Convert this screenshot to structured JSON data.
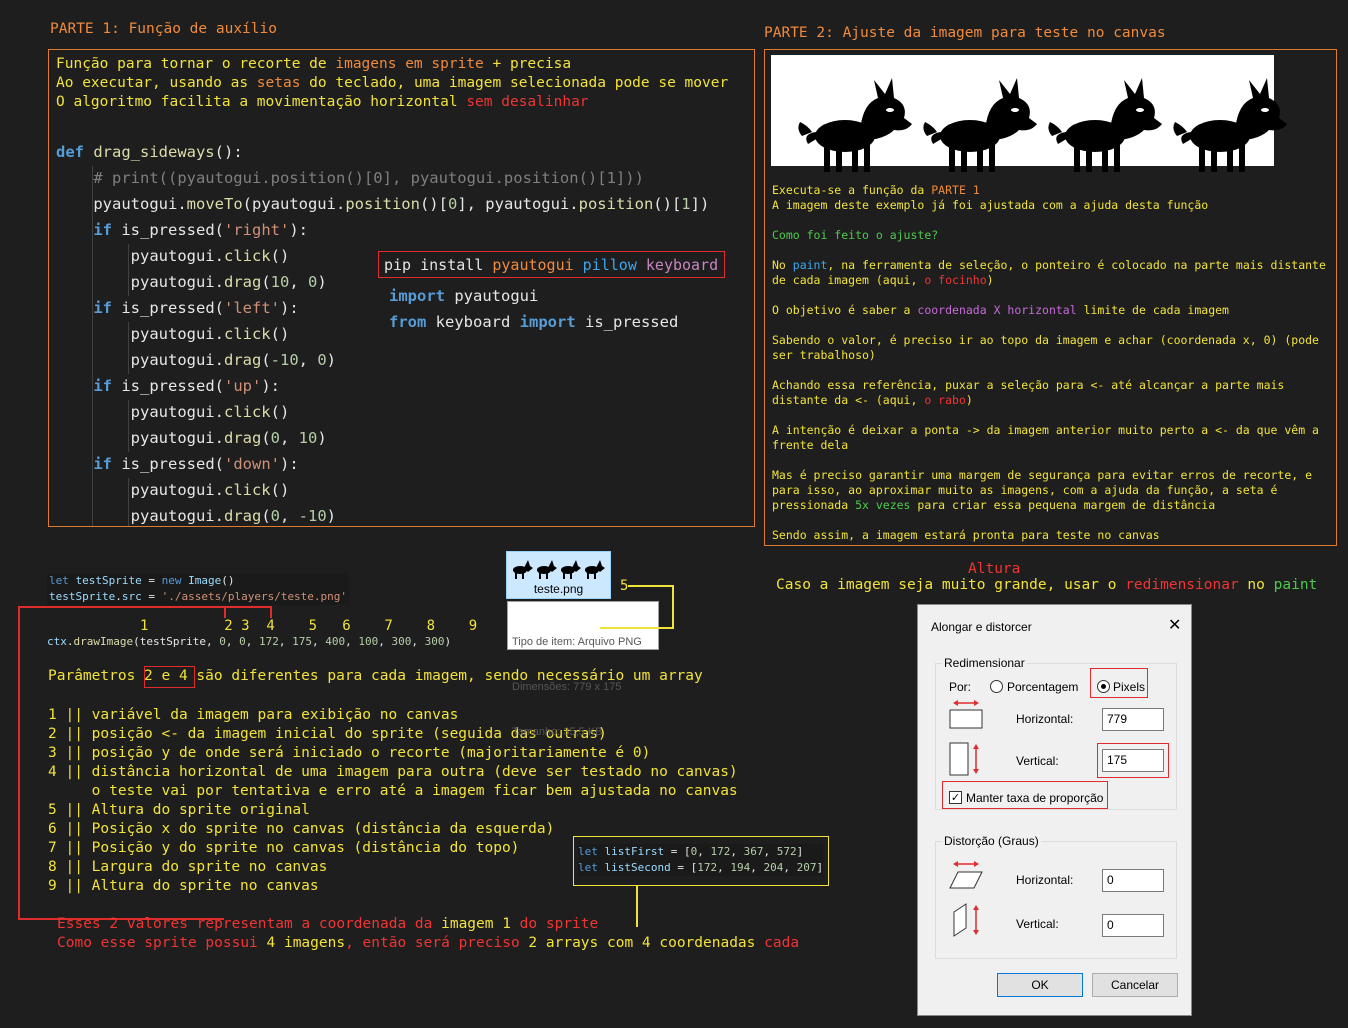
{
  "part1": {
    "title": "PARTE 1: Função de auxílio",
    "desc": [
      [
        {
          "t": "Função para tornar o recorte de ",
          "c": "c-yellow"
        },
        {
          "t": "imagens em sprite",
          "c": "c-orange"
        },
        {
          "t": " + precisa",
          "c": "c-yellow"
        }
      ],
      [
        {
          "t": "Ao executar, usando as ",
          "c": "c-yellow"
        },
        {
          "t": "setas",
          "c": "c-orange"
        },
        {
          "t": " do teclado, uma imagem selecionada pode se mover",
          "c": "c-yellow"
        }
      ],
      [
        {
          "t": "O algoritmo facilita a movimentação horizontal ",
          "c": "c-yellow"
        },
        {
          "t": "sem desalinhar",
          "c": "c-red"
        }
      ]
    ],
    "code_lines": [
      [
        {
          "t": "def ",
          "c": "kw"
        },
        {
          "t": "drag_sideways",
          "c": "fn"
        },
        {
          "t": "():",
          "c": "c-white"
        }
      ],
      [
        {
          "t": "    # print((pyautogui.position()[0], pyautogui.position()[1]))",
          "c": "cmt2"
        }
      ],
      [
        {
          "t": "    pyautogui.",
          "c": "c-white"
        },
        {
          "t": "moveTo",
          "c": "fn"
        },
        {
          "t": "(pyautogui.",
          "c": "c-white"
        },
        {
          "t": "position",
          "c": "fn"
        },
        {
          "t": "()[",
          "c": "c-white"
        },
        {
          "t": "0",
          "c": "num"
        },
        {
          "t": "], pyautogui.",
          "c": "c-white"
        },
        {
          "t": "position",
          "c": "fn"
        },
        {
          "t": "()[",
          "c": "c-white"
        },
        {
          "t": "1",
          "c": "num"
        },
        {
          "t": "])",
          "c": "c-white"
        }
      ],
      [
        {
          "t": "    if ",
          "c": "kw"
        },
        {
          "t": "is_pressed",
          "c": "c-white"
        },
        {
          "t": "(",
          "c": "c-white"
        },
        {
          "t": "'right'",
          "c": "str"
        },
        {
          "t": "):",
          "c": "c-white"
        }
      ],
      [
        {
          "t": "        pyautogui.",
          "c": "c-white"
        },
        {
          "t": "click",
          "c": "fn"
        },
        {
          "t": "()",
          "c": "c-white"
        }
      ],
      [
        {
          "t": "        pyautogui.",
          "c": "c-white"
        },
        {
          "t": "drag",
          "c": "fn"
        },
        {
          "t": "(",
          "c": "c-white"
        },
        {
          "t": "10",
          "c": "num"
        },
        {
          "t": ", ",
          "c": "c-white"
        },
        {
          "t": "0",
          "c": "num"
        },
        {
          "t": ")",
          "c": "c-white"
        }
      ],
      [
        {
          "t": "    if ",
          "c": "kw"
        },
        {
          "t": "is_pressed",
          "c": "c-white"
        },
        {
          "t": "(",
          "c": "c-white"
        },
        {
          "t": "'left'",
          "c": "str"
        },
        {
          "t": "):",
          "c": "c-white"
        }
      ],
      [
        {
          "t": "        pyautogui.",
          "c": "c-white"
        },
        {
          "t": "click",
          "c": "fn"
        },
        {
          "t": "()",
          "c": "c-white"
        }
      ],
      [
        {
          "t": "        pyautogui.",
          "c": "c-white"
        },
        {
          "t": "drag",
          "c": "fn"
        },
        {
          "t": "(",
          "c": "c-white"
        },
        {
          "t": "-10",
          "c": "num"
        },
        {
          "t": ", ",
          "c": "c-white"
        },
        {
          "t": "0",
          "c": "num"
        },
        {
          "t": ")",
          "c": "c-white"
        }
      ],
      [
        {
          "t": "    if ",
          "c": "kw"
        },
        {
          "t": "is_pressed",
          "c": "c-white"
        },
        {
          "t": "(",
          "c": "c-white"
        },
        {
          "t": "'up'",
          "c": "str"
        },
        {
          "t": "):",
          "c": "c-white"
        }
      ],
      [
        {
          "t": "        pyautogui.",
          "c": "c-white"
        },
        {
          "t": "click",
          "c": "fn"
        },
        {
          "t": "()",
          "c": "c-white"
        }
      ],
      [
        {
          "t": "        pyautogui.",
          "c": "c-white"
        },
        {
          "t": "drag",
          "c": "fn"
        },
        {
          "t": "(",
          "c": "c-white"
        },
        {
          "t": "0",
          "c": "num"
        },
        {
          "t": ", ",
          "c": "c-white"
        },
        {
          "t": "10",
          "c": "num"
        },
        {
          "t": ")",
          "c": "c-white"
        }
      ],
      [
        {
          "t": "    if ",
          "c": "kw"
        },
        {
          "t": "is_pressed",
          "c": "c-white"
        },
        {
          "t": "(",
          "c": "c-white"
        },
        {
          "t": "'down'",
          "c": "str"
        },
        {
          "t": "):",
          "c": "c-white"
        }
      ],
      [
        {
          "t": "        pyautogui.",
          "c": "c-white"
        },
        {
          "t": "click",
          "c": "fn"
        },
        {
          "t": "()",
          "c": "c-white"
        }
      ],
      [
        {
          "t": "        pyautogui.",
          "c": "c-white"
        },
        {
          "t": "drag",
          "c": "fn"
        },
        {
          "t": "(",
          "c": "c-white"
        },
        {
          "t": "0",
          "c": "num"
        },
        {
          "t": ", ",
          "c": "c-white"
        },
        {
          "t": "-10",
          "c": "num"
        },
        {
          "t": ")",
          "c": "c-white"
        }
      ]
    ],
    "pip": [
      {
        "t": "pip install ",
        "c": "c-white"
      },
      {
        "t": "pyautogui",
        "c": "c-orange"
      },
      {
        "t": " pillow",
        "c": "c-blue"
      },
      {
        "t": " keyboard",
        "c": "c-purple"
      }
    ],
    "imports": [
      [
        {
          "t": "import",
          "c": "kw"
        },
        {
          "t": " pyautogui",
          "c": "c-white"
        }
      ],
      [
        {
          "t": "from",
          "c": "kw"
        },
        {
          "t": " keyboard ",
          "c": "c-white"
        },
        {
          "t": "import",
          "c": "kw"
        },
        {
          "t": " is_pressed",
          "c": "c-white"
        }
      ]
    ]
  },
  "part2": {
    "title": "PARTE 2: Ajuste da imagem para teste no canvas",
    "paragraphs": [
      [
        [
          {
            "t": "Executa-se a função da ",
            "c": "c-yellow"
          },
          {
            "t": "PARTE 1",
            "c": "c-orange"
          }
        ],
        [
          {
            "t": "A imagem deste exemplo já foi ajustada com a ajuda desta função",
            "c": "c-yellow"
          }
        ]
      ],
      [
        [
          {
            "t": "Como foi feito o ajuste?",
            "c": "c-green"
          }
        ]
      ],
      [
        [
          {
            "t": "No ",
            "c": "c-yellow"
          },
          {
            "t": "paint",
            "c": "c-blue"
          },
          {
            "t": ", na ferramenta de seleção, o ponteiro é colocado na parte mais distante",
            "c": "c-yellow"
          }
        ],
        [
          {
            "t": "de cada imagem (aqui, ",
            "c": "c-yellow"
          },
          {
            "t": "o focinho",
            "c": "c-red"
          },
          {
            "t": ")",
            "c": "c-yellow"
          }
        ]
      ],
      [
        [
          {
            "t": "O objetivo é saber a ",
            "c": "c-yellow"
          },
          {
            "t": "coordenada X horizontal",
            "c": "c-magenta"
          },
          {
            "t": " limite de cada imagem",
            "c": "c-yellow"
          }
        ]
      ],
      [
        [
          {
            "t": "Sabendo o valor, é preciso ir ao topo da imagem e achar (coordenada x, 0) (pode",
            "c": "c-yellow"
          }
        ],
        [
          {
            "t": "ser trabalhoso)",
            "c": "c-yellow"
          }
        ]
      ],
      [
        [
          {
            "t": "Achando essa referência, puxar a seleção para <- até alcançar a parte mais",
            "c": "c-yellow"
          }
        ],
        [
          {
            "t": "distante da <- (aqui, ",
            "c": "c-yellow"
          },
          {
            "t": "o rabo",
            "c": "c-red"
          },
          {
            "t": ")",
            "c": "c-yellow"
          }
        ]
      ],
      [
        [
          {
            "t": "A intenção é deixar a ponta -> da imagem anterior muito perto a <- da que vêm a",
            "c": "c-yellow"
          }
        ],
        [
          {
            "t": "frente dela",
            "c": "c-yellow"
          }
        ]
      ],
      [
        [
          {
            "t": "Mas é preciso garantir uma margem de segurança para evitar erros de recorte, e",
            "c": "c-yellow"
          }
        ],
        [
          {
            "t": "para isso, ao aproximar muito as imagens, com a ajuda da função, a seta é",
            "c": "c-yellow"
          }
        ],
        [
          {
            "t": "pressionada ",
            "c": "c-yellow"
          },
          {
            "t": "5x vezes",
            "c": "c-green"
          },
          {
            "t": " para criar essa pequena margem de distância",
            "c": "c-yellow"
          }
        ]
      ],
      [
        [
          {
            "t": "Sendo assim, a imagem estará pronta para teste no canvas",
            "c": "c-yellow"
          }
        ]
      ]
    ]
  },
  "js": {
    "line1": [
      {
        "t": "let",
        "c": "js-let"
      },
      {
        "t": " testSprite",
        "c": "js-var"
      },
      {
        "t": " = ",
        "c": "c-white"
      },
      {
        "t": "new",
        "c": "js-let"
      },
      {
        "t": " Image",
        "c": "js-var"
      },
      {
        "t": "()",
        "c": "c-white"
      }
    ],
    "line2": [
      {
        "t": "testSprite",
        "c": "js-var"
      },
      {
        "t": ".",
        "c": "c-white"
      },
      {
        "t": "src",
        "c": "js-var"
      },
      {
        "t": " = ",
        "c": "c-white"
      },
      {
        "t": "'./assets/players/teste.png'",
        "c": "str"
      }
    ],
    "param_numbers": "1         2 3  4    5   6    7    8    9",
    "draw_line": [
      {
        "t": "ctx",
        "c": "js-var"
      },
      {
        "t": ".",
        "c": "c-white"
      },
      {
        "t": "drawImage",
        "c": "fn"
      },
      {
        "t": "(testSprite, ",
        "c": "c-white"
      },
      {
        "t": "0",
        "c": "num"
      },
      {
        "t": ", ",
        "c": "c-white"
      },
      {
        "t": "0",
        "c": "num"
      },
      {
        "t": ", ",
        "c": "c-white"
      },
      {
        "t": "172",
        "c": "num"
      },
      {
        "t": ", ",
        "c": "c-white"
      },
      {
        "t": "175",
        "c": "num"
      },
      {
        "t": ", ",
        "c": "c-white"
      },
      {
        "t": "400",
        "c": "num"
      },
      {
        "t": ", ",
        "c": "c-white"
      },
      {
        "t": "100",
        "c": "num"
      },
      {
        "t": ", ",
        "c": "c-white"
      },
      {
        "t": "300",
        "c": "num"
      },
      {
        "t": ", ",
        "c": "c-white"
      },
      {
        "t": "300",
        "c": "num"
      },
      {
        "t": ")",
        "c": "c-white"
      }
    ]
  },
  "params_line": [
    {
      "t": "Parâmetros ",
      "c": "c-yellow"
    },
    {
      "t": "2 e 4",
      "c": "c-yellow"
    },
    {
      "t": " são diferentes para cada imagem, sendo necessário um array",
      "c": "c-yellow"
    }
  ],
  "param_list": [
    "1 || variável da imagem para exibição no canvas",
    "2 || posição <- da imagem inicial do sprite (seguida das outras)",
    "3 || posição y de onde será iniciado o recorte (majoritariamente é 0)",
    "4 || distância horizontal de uma imagem para outra (deve ser testado no canvas)",
    "     o teste vai por tentativa e erro até a imagem ficar bem ajustada no canvas",
    "5 || Altura do sprite original",
    "6 || Posição x do sprite no canvas (distância da esquerda)",
    "7 || Posição y do sprite no canvas (distância do topo)",
    "8 || Largura do sprite no canvas",
    "9 || Altura do sprite no canvas"
  ],
  "red_note": [
    [
      {
        "t": "Esses 2 valores representam a coordenada da ",
        "c": "c-red"
      },
      {
        "t": "imagem 1",
        "c": "c-yellow"
      },
      {
        "t": " do sprite",
        "c": "c-red"
      }
    ],
    [
      {
        "t": "Como esse sprite possui ",
        "c": "c-red"
      },
      {
        "t": "4 imagens",
        "c": "c-yellow"
      },
      {
        "t": ", então será preciso ",
        "c": "c-red"
      },
      {
        "t": "2 arrays com 4 coordenadas",
        "c": "c-yellow"
      },
      {
        "t": " cada",
        "c": "c-red"
      }
    ]
  ],
  "file": {
    "name": "teste.png",
    "tooltip": [
      "Tipo de item: Arquivo PNG",
      "Dimensões: 779 x 175",
      "Tamanho: 35,5 KB"
    ],
    "marker": "5"
  },
  "arrays": {
    "first": [
      {
        "t": "let",
        "c": "js-let"
      },
      {
        "t": " listFirst",
        "c": "js-var"
      },
      {
        "t": " = [",
        "c": "c-white"
      },
      {
        "t": "0",
        "c": "num"
      },
      {
        "t": ", ",
        "c": "c-white"
      },
      {
        "t": "172",
        "c": "num"
      },
      {
        "t": ", ",
        "c": "c-white"
      },
      {
        "t": "367",
        "c": "num"
      },
      {
        "t": ", ",
        "c": "c-white"
      },
      {
        "t": "572",
        "c": "num"
      },
      {
        "t": "]",
        "c": "c-white"
      }
    ],
    "second": [
      {
        "t": "let",
        "c": "js-let"
      },
      {
        "t": " listSecond",
        "c": "js-var"
      },
      {
        "t": " = [",
        "c": "c-white"
      },
      {
        "t": "172",
        "c": "num"
      },
      {
        "t": ", ",
        "c": "c-white"
      },
      {
        "t": "194",
        "c": "num"
      },
      {
        "t": ", ",
        "c": "c-white"
      },
      {
        "t": "204",
        "c": "num"
      },
      {
        "t": ", ",
        "c": "c-white"
      },
      {
        "t": "207",
        "c": "num"
      },
      {
        "t": "]",
        "c": "c-white"
      }
    ]
  },
  "resize": {
    "altura": "Altura",
    "note": [
      {
        "t": "Caso a imagem seja muito grande, usar o ",
        "c": "c-yellow"
      },
      {
        "t": "redimensionar",
        "c": "c-red"
      },
      {
        "t": " no ",
        "c": "c-yellow"
      },
      {
        "t": "paint",
        "c": "c-green"
      }
    ]
  },
  "dialog": {
    "title": "Alongar e distorcer",
    "resize_group": "Redimensionar",
    "by_label": "Por:",
    "percent_label": "Porcentagem",
    "pixels_label": "Pixels",
    "horizontal_label": "Horizontal:",
    "horizontal_value": "779",
    "vertical_label": "Vertical:",
    "vertical_value": "175",
    "keep_ratio": "Manter taxa de proporção",
    "distort_group": "Distorção (Graus)",
    "skew_h_label": "Horizontal:",
    "skew_h_value": "0",
    "skew_v_label": "Vertical:",
    "skew_v_value": "0",
    "ok": "OK",
    "cancel": "Cancelar"
  }
}
